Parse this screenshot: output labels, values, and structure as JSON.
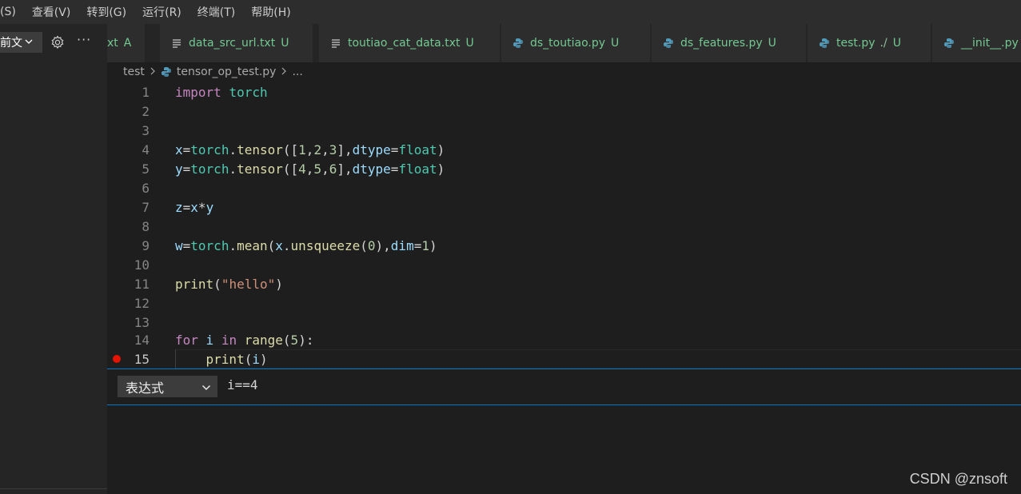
{
  "menu": [
    "(S)",
    "查看(V)",
    "转到(G)",
    "运行(R)",
    "终端(T)",
    "帮助(H)"
  ],
  "sidebar": {
    "select_text": "前文",
    "more_label": "···"
  },
  "tabs": [
    {
      "label": "xt",
      "status": "A",
      "icon": "none"
    },
    {
      "label": "data_src_url.txt",
      "status": "U",
      "icon": "text-file-icon"
    },
    {
      "label": "toutiao_cat_data.txt",
      "status": "U",
      "icon": "text-file-icon"
    },
    {
      "label": "ds_toutiao.py",
      "status": "U",
      "icon": "python-icon"
    },
    {
      "label": "ds_features.py",
      "status": "U",
      "icon": "python-icon"
    },
    {
      "label": "test.py",
      "path": "./",
      "status": "U",
      "icon": "python-icon"
    },
    {
      "label": "__init__.py",
      "status": "",
      "icon": "python-icon"
    }
  ],
  "breadcrumb": {
    "folder": "test",
    "file": "tensor_op_test.py",
    "more": "..."
  },
  "code": {
    "line_numbers": [
      "1",
      "2",
      "3",
      "4",
      "5",
      "6",
      "7",
      "8",
      "9",
      "10",
      "11",
      "12",
      "13",
      "14",
      "15"
    ],
    "active_line": "15",
    "breakpoint_line": "15"
  },
  "breakpoint_widget": {
    "select_value": "表达式",
    "expression": "i==4"
  },
  "watermark": "CSDN @znsoft"
}
